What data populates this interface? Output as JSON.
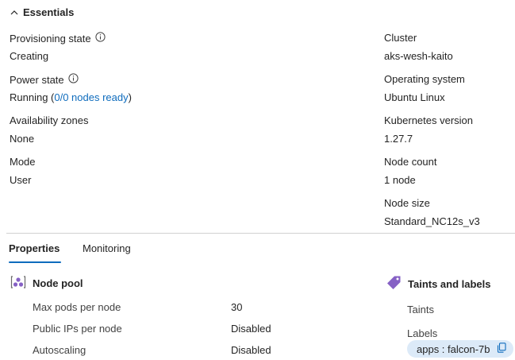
{
  "essentials": {
    "toggle_label": "Essentials",
    "left": {
      "provisioning_state": {
        "label": "Provisioning state",
        "value": "Creating"
      },
      "power_state": {
        "label": "Power state",
        "value_prefix": "Running (",
        "value_link": "0/0 nodes ready",
        "value_suffix": ")"
      },
      "availability_zones": {
        "label": "Availability zones",
        "value": "None"
      },
      "mode": {
        "label": "Mode",
        "value": "User"
      }
    },
    "right": {
      "cluster": {
        "label": "Cluster",
        "value": "aks-wesh-kaito"
      },
      "operating_system": {
        "label": "Operating system",
        "value": "Ubuntu Linux"
      },
      "kubernetes_version": {
        "label": "Kubernetes version",
        "value": "1.27.7"
      },
      "node_count": {
        "label": "Node count",
        "value": "1 node"
      },
      "node_size": {
        "label": "Node size",
        "value": "Standard_NC12s_v3"
      }
    }
  },
  "tabs": [
    {
      "label": "Properties",
      "active": true
    },
    {
      "label": "Monitoring",
      "active": false
    }
  ],
  "node_pool": {
    "title": "Node pool",
    "icon": "node-pool-icon",
    "rows": [
      {
        "label": "Max pods per node",
        "value": "30"
      },
      {
        "label": "Public IPs per node",
        "value": "Disabled"
      },
      {
        "label": "Autoscaling",
        "value": "Disabled"
      }
    ]
  },
  "taints_labels": {
    "title": "Taints and labels",
    "icon": "tag-icon",
    "taints_label": "Taints",
    "labels_label": "Labels",
    "label_chip": "apps : falcon-7b"
  },
  "colors": {
    "link": "#0f6cbd",
    "text": "#242424",
    "chip_bg": "#dceaf8",
    "tag_purple": "#8661c5",
    "tab_accent": "#0f6cbd"
  }
}
